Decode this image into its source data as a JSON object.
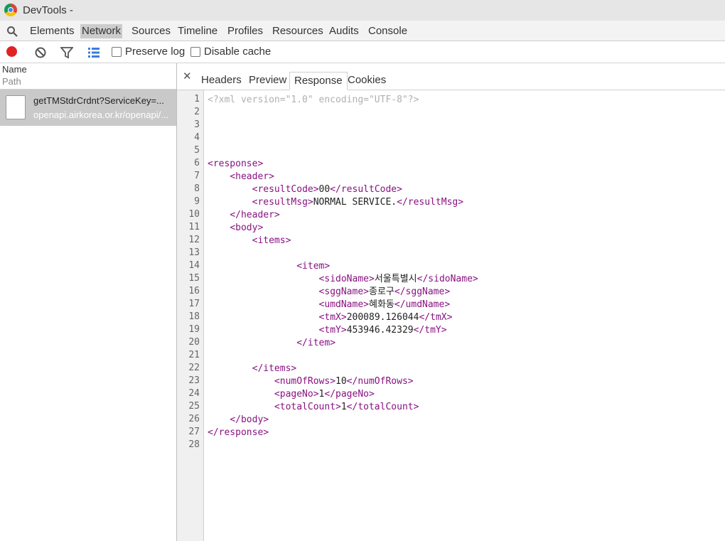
{
  "window": {
    "title": "DevTools -"
  },
  "panel_tabs": [
    {
      "label": "Elements",
      "selected": false
    },
    {
      "label": "Network",
      "selected": true
    },
    {
      "label": "Sources",
      "selected": false
    },
    {
      "label": "Timeline",
      "selected": false
    },
    {
      "label": "Profiles",
      "selected": false
    },
    {
      "label": "Resources",
      "selected": false
    },
    {
      "label": "Audits",
      "selected": false
    },
    {
      "label": "Console",
      "selected": false
    }
  ],
  "toolbar": {
    "preserve_log_label": "Preserve log",
    "disable_cache_label": "Disable cache",
    "preserve_log_checked": false,
    "disable_cache_checked": false
  },
  "requests": {
    "header_name": "Name",
    "header_path": "Path",
    "rows": [
      {
        "name": "getTMStdrCrdnt?ServiceKey=...",
        "path": "openapi.airkorea.or.kr/openapi/..."
      }
    ]
  },
  "detail_tabs": [
    {
      "label": "Headers",
      "selected": false
    },
    {
      "label": "Preview",
      "selected": false
    },
    {
      "label": "Response",
      "selected": true
    },
    {
      "label": "Cookies",
      "selected": false
    }
  ],
  "response_lines": [
    {
      "n": "1",
      "indent": "",
      "open": "",
      "text": "",
      "close": "",
      "decl": "<?xml version=\"1.0\" encoding=\"UTF-8\"?>"
    },
    {
      "n": "2",
      "indent": "",
      "open": "",
      "text": "",
      "close": "",
      "decl": ""
    },
    {
      "n": "3",
      "indent": "",
      "open": "",
      "text": "",
      "close": "",
      "decl": ""
    },
    {
      "n": "4",
      "indent": "",
      "open": "",
      "text": "",
      "close": "",
      "decl": ""
    },
    {
      "n": "5",
      "indent": "",
      "open": "",
      "text": "",
      "close": "",
      "decl": ""
    },
    {
      "n": "6",
      "indent": "",
      "open": "<response>",
      "text": "",
      "close": "",
      "decl": ""
    },
    {
      "n": "7",
      "indent": "    ",
      "open": "<header>",
      "text": "",
      "close": "",
      "decl": ""
    },
    {
      "n": "8",
      "indent": "        ",
      "open": "<resultCode>",
      "text": "00",
      "close": "</resultCode>",
      "decl": ""
    },
    {
      "n": "9",
      "indent": "        ",
      "open": "<resultMsg>",
      "text": "NORMAL SERVICE.",
      "close": "</resultMsg>",
      "decl": ""
    },
    {
      "n": "10",
      "indent": "    ",
      "open": "</header>",
      "text": "",
      "close": "",
      "decl": ""
    },
    {
      "n": "11",
      "indent": "    ",
      "open": "<body>",
      "text": "",
      "close": "",
      "decl": ""
    },
    {
      "n": "12",
      "indent": "        ",
      "open": "<items>",
      "text": "",
      "close": "",
      "decl": ""
    },
    {
      "n": "13",
      "indent": "",
      "open": "",
      "text": "",
      "close": "",
      "decl": ""
    },
    {
      "n": "14",
      "indent": "                ",
      "open": "<item>",
      "text": "",
      "close": "",
      "decl": ""
    },
    {
      "n": "15",
      "indent": "                    ",
      "open": "<sidoName>",
      "text": "서울특별시",
      "close": "</sidoName>",
      "decl": ""
    },
    {
      "n": "16",
      "indent": "                    ",
      "open": "<sggName>",
      "text": "종로구",
      "close": "</sggName>",
      "decl": ""
    },
    {
      "n": "17",
      "indent": "                    ",
      "open": "<umdName>",
      "text": "혜화동",
      "close": "</umdName>",
      "decl": ""
    },
    {
      "n": "18",
      "indent": "                    ",
      "open": "<tmX>",
      "text": "200089.126044",
      "close": "</tmX>",
      "decl": ""
    },
    {
      "n": "19",
      "indent": "                    ",
      "open": "<tmY>",
      "text": "453946.42329",
      "close": "</tmY>",
      "decl": ""
    },
    {
      "n": "20",
      "indent": "                ",
      "open": "</item>",
      "text": "",
      "close": "",
      "decl": ""
    },
    {
      "n": "21",
      "indent": "",
      "open": "",
      "text": "",
      "close": "",
      "decl": ""
    },
    {
      "n": "22",
      "indent": "        ",
      "open": "</items>",
      "text": "",
      "close": "",
      "decl": ""
    },
    {
      "n": "23",
      "indent": "            ",
      "open": "<numOfRows>",
      "text": "10",
      "close": "</numOfRows>",
      "decl": ""
    },
    {
      "n": "24",
      "indent": "            ",
      "open": "<pageNo>",
      "text": "1",
      "close": "</pageNo>",
      "decl": ""
    },
    {
      "n": "25",
      "indent": "            ",
      "open": "<totalCount>",
      "text": "1",
      "close": "</totalCount>",
      "decl": ""
    },
    {
      "n": "26",
      "indent": "    ",
      "open": "</body>",
      "text": "",
      "close": "",
      "decl": ""
    },
    {
      "n": "27",
      "indent": "",
      "open": "</response>",
      "text": "",
      "close": "",
      "decl": ""
    },
    {
      "n": "28",
      "indent": "",
      "open": "",
      "text": "",
      "close": "",
      "decl": ""
    }
  ],
  "icons": {
    "app": "chrome-logo-icon",
    "search": "search-icon",
    "record": "record-icon",
    "clear": "clear-icon",
    "filter": "filter-icon",
    "view": "large-rows-icon",
    "close": "close-icon",
    "file": "file-icon"
  },
  "colors": {
    "xml_tag": "#881280",
    "xml_declaration": "#b0b0b0",
    "record": "#e02424",
    "selected_row": "#c9c9c9"
  }
}
